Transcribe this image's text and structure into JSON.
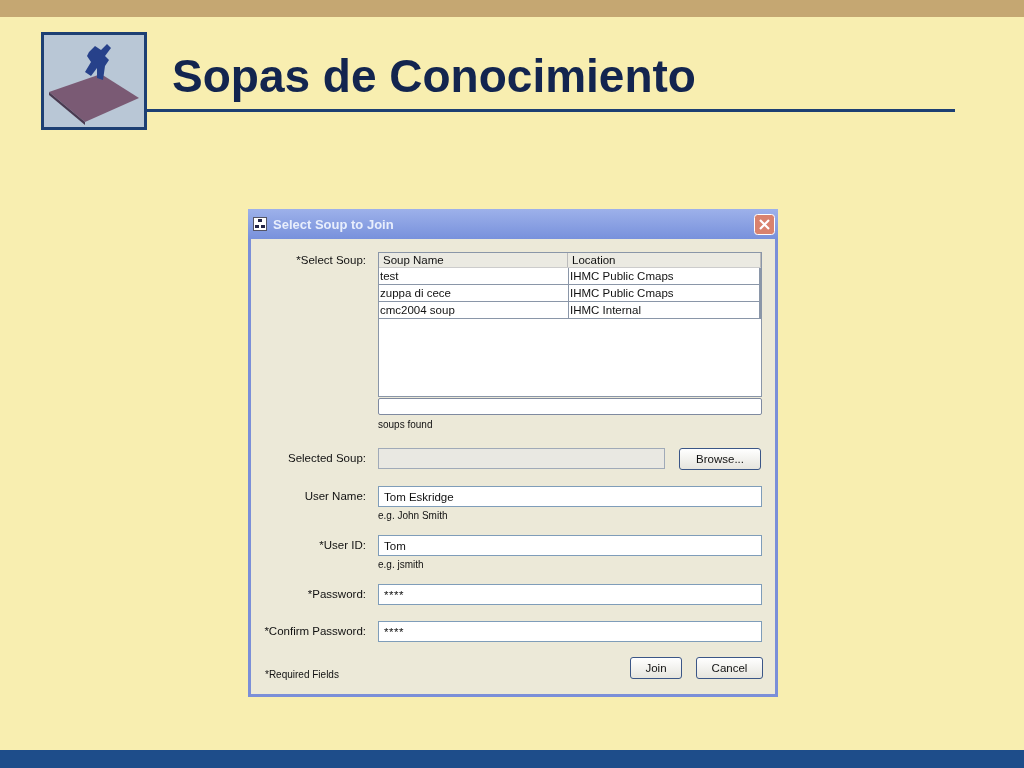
{
  "slide": {
    "title": "Sopas de Conocimiento"
  },
  "dialog": {
    "title": "Select Soup to Join",
    "soup_list": {
      "label": "*Select Soup:",
      "columns": [
        "Soup Name",
        "Location"
      ],
      "rows": [
        [
          "test",
          "IHMC Public Cmaps"
        ],
        [
          "zuppa di cece",
          "IHMC Public Cmaps"
        ],
        [
          "cmc2004 soup",
          "IHMC Internal"
        ]
      ],
      "status": "soups found"
    },
    "fields": [
      {
        "kind": "browse",
        "label": "Selected Soup:",
        "button": "Browse..."
      },
      {
        "kind": "text",
        "label": "User Name:",
        "value": "Tom Eskridge",
        "hint": "e.g. John Smith"
      },
      {
        "kind": "text",
        "label": "*User ID:",
        "value": "Tom",
        "hint": "e.g. jsmith"
      },
      {
        "kind": "password",
        "label": "*Password:",
        "value": "****"
      },
      {
        "kind": "password",
        "label": "*Confirm Password:",
        "value": "****"
      }
    ],
    "note": "*Required Fields",
    "buttons": [
      "Join",
      "Cancel"
    ]
  }
}
